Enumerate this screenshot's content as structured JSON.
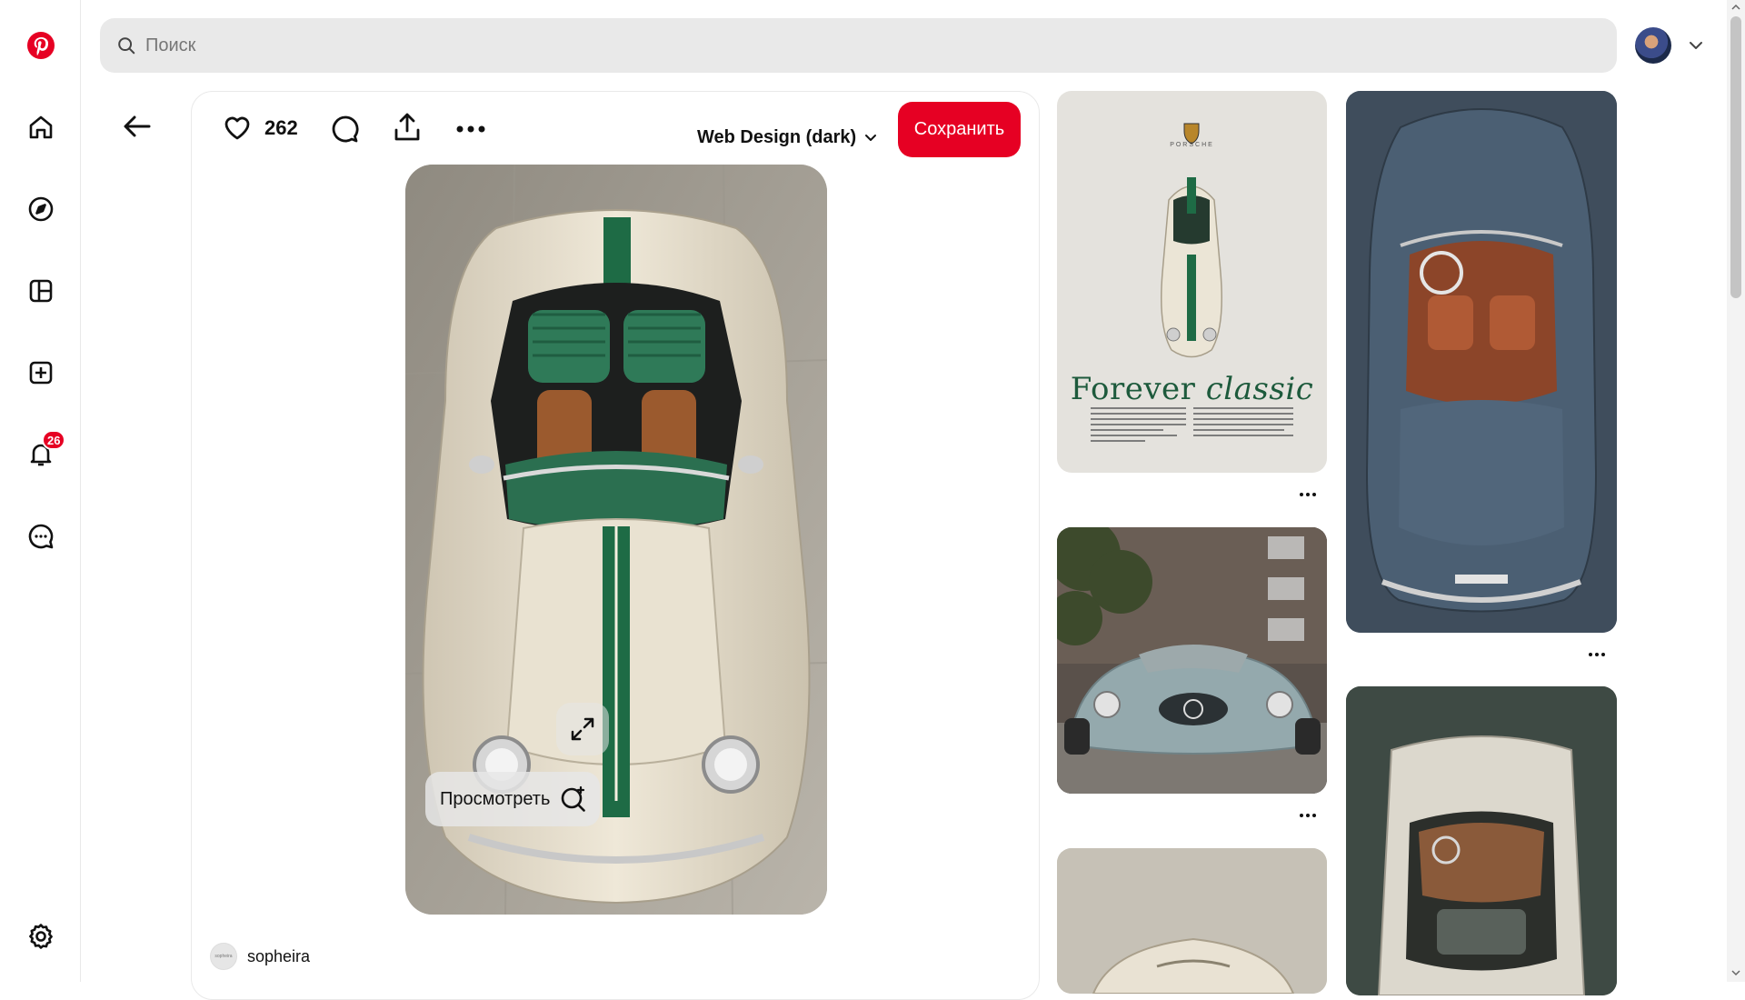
{
  "search": {
    "placeholder": "Поиск"
  },
  "notifications": {
    "count": "26"
  },
  "pin": {
    "like_count": "262",
    "board_name": "Web Design (dark)",
    "save_label": "Сохранить",
    "visual_search_label": "Просмотреть",
    "author_name": "sopheira",
    "author_avatar_text": "sopheira"
  },
  "poster": {
    "brand": "PORSCHE",
    "title_plain": "Forever",
    "title_italic": "classic"
  },
  "colors": {
    "brand_red": "#e60023",
    "stripe_green": "#1e6b45"
  }
}
